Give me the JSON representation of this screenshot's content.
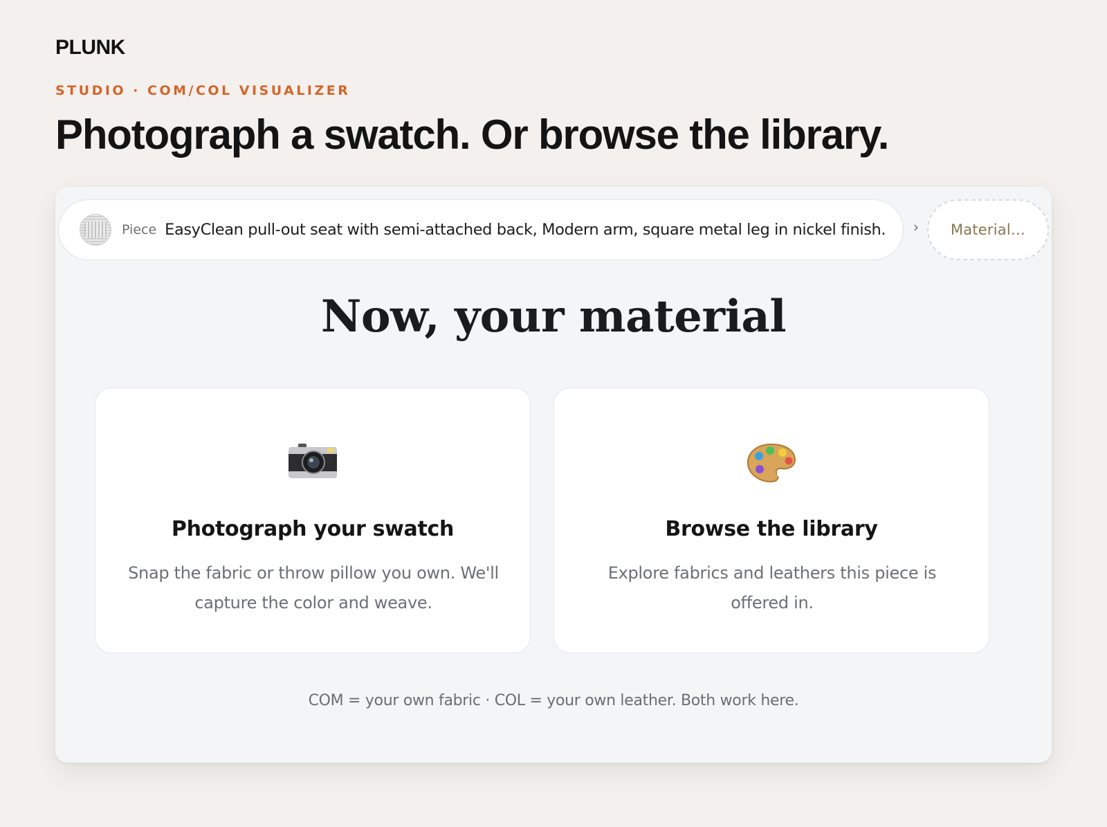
{
  "brand": "PLUNK",
  "eyebrow": "STUDIO · COM/COL VISUALIZER",
  "headline": "Photograph a swatch. Or browse the library.",
  "breadcrumb": {
    "piece_label": "Piece",
    "piece_description": "EasyClean pull-out seat with semi-attached back, Modern arm, square metal leg in nickel finish.",
    "separator": "›",
    "next_step_label": "Material…"
  },
  "section_title": "Now, your material",
  "options": [
    {
      "icon": "camera-icon",
      "title": "Photograph your swatch",
      "description": "Snap the fabric or throw pillow you own. We'll capture the color and weave."
    },
    {
      "icon": "palette-icon",
      "title": "Browse the library",
      "description": "Explore fabrics and leathers this piece is offered in."
    }
  ],
  "footnote": "COM = your own fabric · COL = your own leather. Both work here.",
  "colors": {
    "accent": "#d4652a",
    "page_background": "#f3f0ed",
    "panel_background": "#f4f5f7",
    "material_text": "#8a7650"
  }
}
